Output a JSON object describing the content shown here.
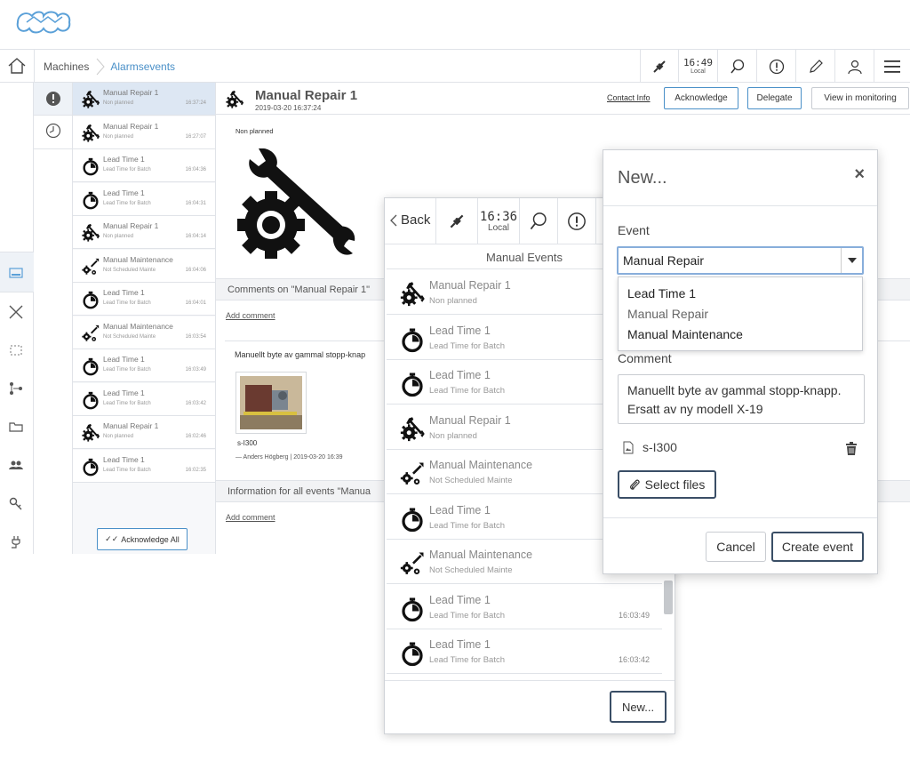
{
  "breadcrumb": {
    "root": "Machines",
    "current": "Alarmsevents"
  },
  "topbar": {
    "clock_time": "16:49",
    "clock_label": "Local"
  },
  "events": [
    {
      "icon": "repair-icon",
      "title": "Manual Repair 1",
      "sub": "Non planned",
      "time": "16:37:24",
      "selected": true
    },
    {
      "icon": "repair-icon",
      "title": "Manual Repair 1",
      "sub": "Non planned",
      "time": "16:27:07"
    },
    {
      "icon": "stopwatch-icon",
      "title": "Lead Time 1",
      "sub": "Lead Time for Batch",
      "time": "16:04:36"
    },
    {
      "icon": "stopwatch-icon",
      "title": "Lead Time 1",
      "sub": "Lead Time for Batch",
      "time": "16:04:31"
    },
    {
      "icon": "repair-icon",
      "title": "Manual Repair 1",
      "sub": "Non planned",
      "time": "16:04:14"
    },
    {
      "icon": "maintenance-icon",
      "title": "Manual Maintenance",
      "sub": "Not Scheduled Mainte",
      "time": "16:04:06"
    },
    {
      "icon": "stopwatch-icon",
      "title": "Lead Time 1",
      "sub": "Lead Time for Batch",
      "time": "16:04:01"
    },
    {
      "icon": "maintenance-icon",
      "title": "Manual Maintenance",
      "sub": "Not Scheduled Mainte",
      "time": "16:03:54"
    },
    {
      "icon": "stopwatch-icon",
      "title": "Lead Time 1",
      "sub": "Lead Time for Batch",
      "time": "16:03:49"
    },
    {
      "icon": "stopwatch-icon",
      "title": "Lead Time 1",
      "sub": "Lead Time for Batch",
      "time": "16:03:42"
    },
    {
      "icon": "repair-icon",
      "title": "Manual Repair 1",
      "sub": "Non planned",
      "time": "16:02:46"
    },
    {
      "icon": "stopwatch-icon",
      "title": "Lead Time 1",
      "sub": "Lead Time for Batch",
      "time": "16:02:35"
    }
  ],
  "ack_all": "Acknowledge All",
  "detail": {
    "title": "Manual Repair 1",
    "date": "2019-03-20 16:37:24",
    "contact": "Contact Info",
    "acknowledge": "Acknowledge",
    "delegate": "Delegate",
    "view": "View in monitoring",
    "type": "Non planned",
    "comments_header": "Comments on \"Manual Repair 1\"",
    "add_comment": "Add comment",
    "comment_text": "Manuellt byte av gammal stopp-knap",
    "attachment": "s-I300",
    "author": "— Anders Högberg | 2019-03-20 16:39",
    "info_header": "Information for all events \"Manua",
    "add_comment2": "Add comment"
  },
  "mobile": {
    "back": "Back",
    "clock_time": "16:36",
    "clock_label": "Local",
    "list_title": "Manual Events",
    "items": [
      {
        "icon": "repair-icon",
        "title": "Manual Repair 1",
        "sub": "Non planned",
        "time": ""
      },
      {
        "icon": "stopwatch-icon",
        "title": "Lead Time 1",
        "sub": "Lead Time for Batch",
        "time": ""
      },
      {
        "icon": "stopwatch-icon",
        "title": "Lead Time 1",
        "sub": "Lead Time for Batch",
        "time": ""
      },
      {
        "icon": "repair-icon",
        "title": "Manual Repair 1",
        "sub": "Non planned",
        "time": ""
      },
      {
        "icon": "maintenance-icon",
        "title": "Manual Maintenance",
        "sub": "Not Scheduled Mainte",
        "time": ""
      },
      {
        "icon": "stopwatch-icon",
        "title": "Lead Time 1",
        "sub": "Lead Time for Batch",
        "time": ""
      },
      {
        "icon": "maintenance-icon",
        "title": "Manual Maintenance",
        "sub": "Not Scheduled Mainte",
        "time": ""
      },
      {
        "icon": "stopwatch-icon",
        "title": "Lead Time 1",
        "sub": "Lead Time for Batch",
        "time": "16:03:49"
      },
      {
        "icon": "stopwatch-icon",
        "title": "Lead Time 1",
        "sub": "Lead Time for Batch",
        "time": "16:03:42"
      }
    ],
    "new_button": "New..."
  },
  "dialog": {
    "title": "New...",
    "close": "×",
    "event_label": "Event",
    "event_value": "Manual Repair",
    "options": [
      "Lead Time 1",
      "Manual Repair",
      "Manual Maintenance"
    ],
    "comment_label": "Comment",
    "comment_line1": "Manuellt byte av gammal stopp-knapp.",
    "comment_line2": "Ersatt av ny modell X-19",
    "file_name": "s-I300",
    "select_files": "Select files",
    "cancel": "Cancel",
    "create": "Create event"
  }
}
